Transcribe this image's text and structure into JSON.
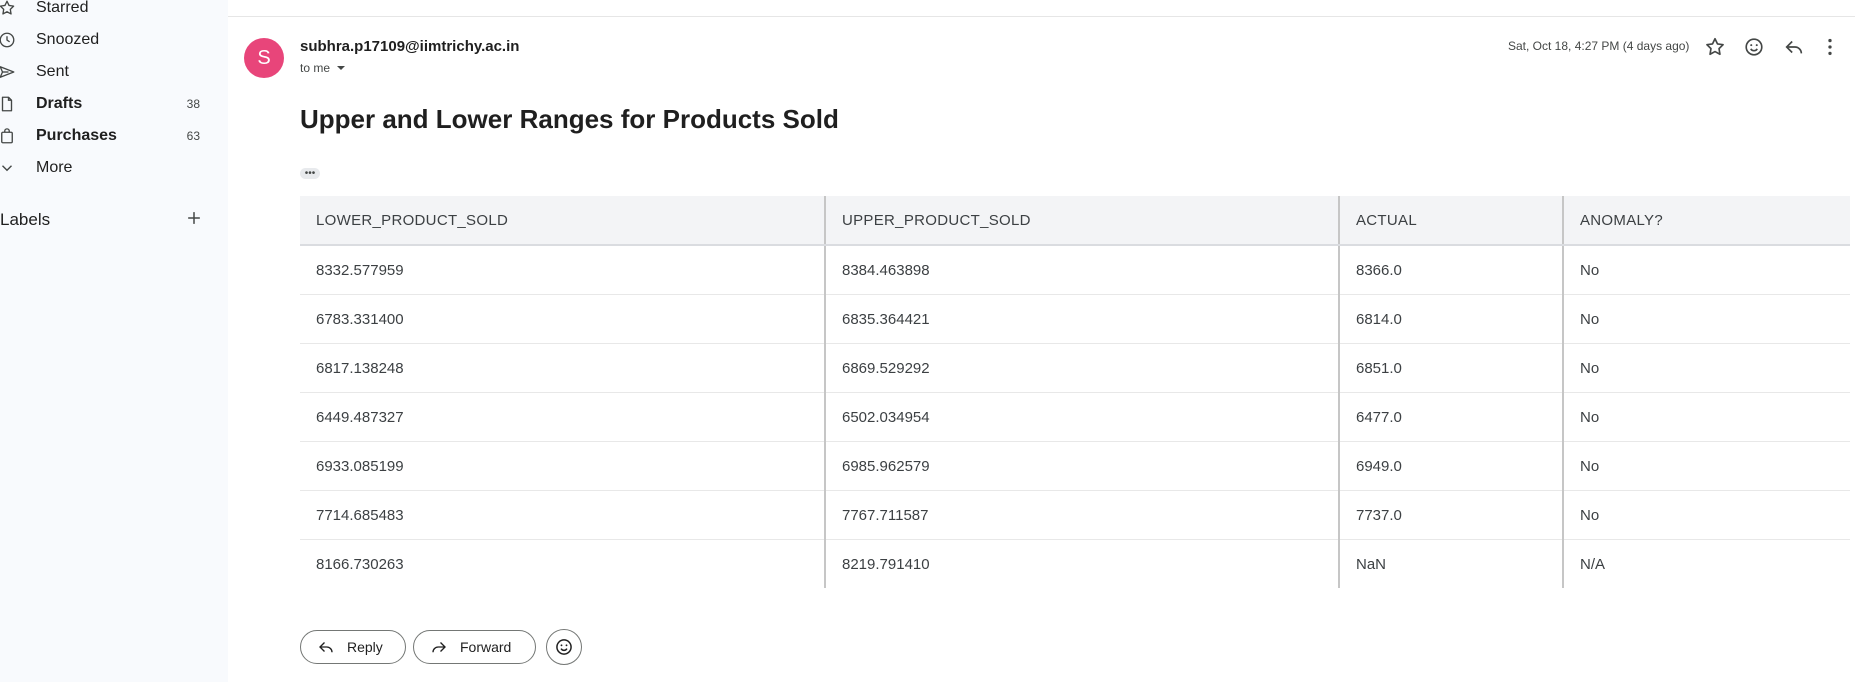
{
  "sidebar": {
    "items": [
      {
        "label": "Starred",
        "count": "",
        "icon": "star-icon"
      },
      {
        "label": "Snoozed",
        "count": "",
        "icon": "clock-icon"
      },
      {
        "label": "Sent",
        "count": "",
        "icon": "send-icon"
      },
      {
        "label": "Drafts",
        "count": "38",
        "icon": "draft-icon"
      },
      {
        "label": "Purchases",
        "count": "63",
        "icon": "shopping-bag-icon"
      },
      {
        "label": "More",
        "count": "",
        "icon": "chevron-down-icon"
      }
    ],
    "labels_heading": "Labels"
  },
  "email": {
    "avatar_letter": "S",
    "avatar_color": "#e8457a",
    "sender": "subhra.p17109@iimtrichy.ac.in",
    "to": "to me",
    "date": "Sat, Oct 18, 4:27 PM (4 days ago)",
    "subject": "Upper and Lower Ranges for Products Sold",
    "ellipsis": "•••"
  },
  "table": {
    "headers": [
      "LOWER_PRODUCT_SOLD",
      "UPPER_PRODUCT_SOLD",
      "ACTUAL",
      "ANOMALY?"
    ],
    "rows": [
      [
        "8332.577959",
        "8384.463898",
        "8366.0",
        "No"
      ],
      [
        "6783.331400",
        "6835.364421",
        "6814.0",
        "No"
      ],
      [
        "6817.138248",
        "6869.529292",
        "6851.0",
        "No"
      ],
      [
        "6449.487327",
        "6502.034954",
        "6477.0",
        "No"
      ],
      [
        "6933.085199",
        "6985.962579",
        "6949.0",
        "No"
      ],
      [
        "7714.685483",
        "7767.711587",
        "7737.0",
        "No"
      ],
      [
        "8166.730263",
        "8219.791410",
        "NaN",
        "N/A"
      ]
    ]
  },
  "actions": {
    "reply": "Reply",
    "forward": "Forward"
  }
}
